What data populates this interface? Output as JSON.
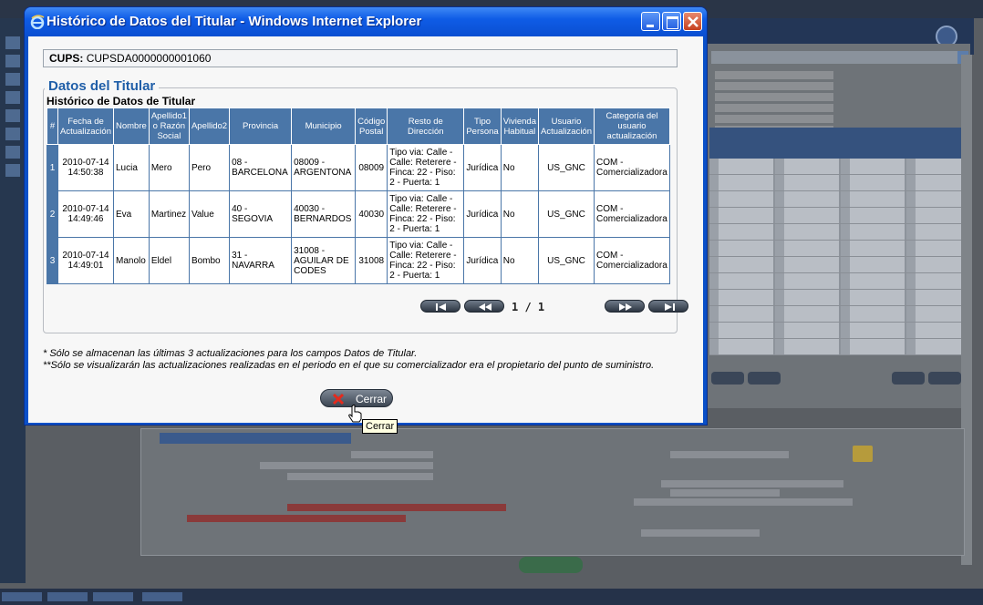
{
  "window": {
    "title": "Histórico de Datos del Titular - Windows Internet Explorer",
    "colors": {
      "title_bar": "#0f5ce6",
      "close_button": "#c6401f"
    }
  },
  "cups": {
    "label": "CUPS:",
    "value": "CUPSDA0000000001060"
  },
  "section": {
    "legend": "Datos del Titular",
    "caption": "Histórico de Datos de Titular"
  },
  "table": {
    "headers": [
      "#",
      "Fecha de Actualización",
      "Nombre",
      "Apellido1 o Razón Social",
      "Apellido2",
      "Provincia",
      "Municipio",
      "Código Postal",
      "Resto de Dirección",
      "Tipo Persona",
      "Vivienda Habitual",
      "Usuario Actualización",
      "Categoría del usuario actualización"
    ],
    "rows": [
      [
        "1",
        "2010-07-14 14:50:38",
        "Lucia",
        "Mero",
        "Pero",
        "08 - BARCELONA",
        "08009 - ARGENTONA",
        "08009",
        "Tipo via: Calle - Calle: Reterere - Finca: 22 - Piso: 2 - Puerta: 1",
        "Jurídica",
        "No",
        "US_GNC",
        "COM - Comercializadora"
      ],
      [
        "2",
        "2010-07-14 14:49:46",
        "Eva",
        "Martinez",
        "Value",
        "40 - SEGOVIA",
        "40030 - BERNARDOS",
        "40030",
        "Tipo via: Calle - Calle: Reterere - Finca: 22 - Piso: 2 - Puerta: 1",
        "Jurídica",
        "No",
        "US_GNC",
        "COM - Comercializadora"
      ],
      [
        "3",
        "2010-07-14 14:49:01",
        "Manolo",
        "Eldel",
        "Bombo",
        "31 - NAVARRA",
        "31008 - AGUILAR DE CODES",
        "31008",
        "Tipo via: Calle - Calle: Reterere - Finca: 22 - Piso: 2 - Puerta: 1",
        "Jurídica",
        "No",
        "US_GNC",
        "COM - Comercializadora"
      ]
    ],
    "header_color": "#4a76a8"
  },
  "pager": {
    "indicator": "1 / 1",
    "buttons": [
      "first-page-icon",
      "previous-page-icon",
      "next-page-icon",
      "last-page-icon"
    ]
  },
  "notes": [
    "* Sólo se almacenan las últimas 3 actualizaciones para los campos Datos de Titular.",
    "**Sólo se visualizarán las actualizaciones realizadas en el periodo en el que su comercializador era el propietario del punto de suministro."
  ],
  "close_button": {
    "label": "Cerrar",
    "icon": "close-x-icon",
    "tooltip": "Cerrar"
  }
}
